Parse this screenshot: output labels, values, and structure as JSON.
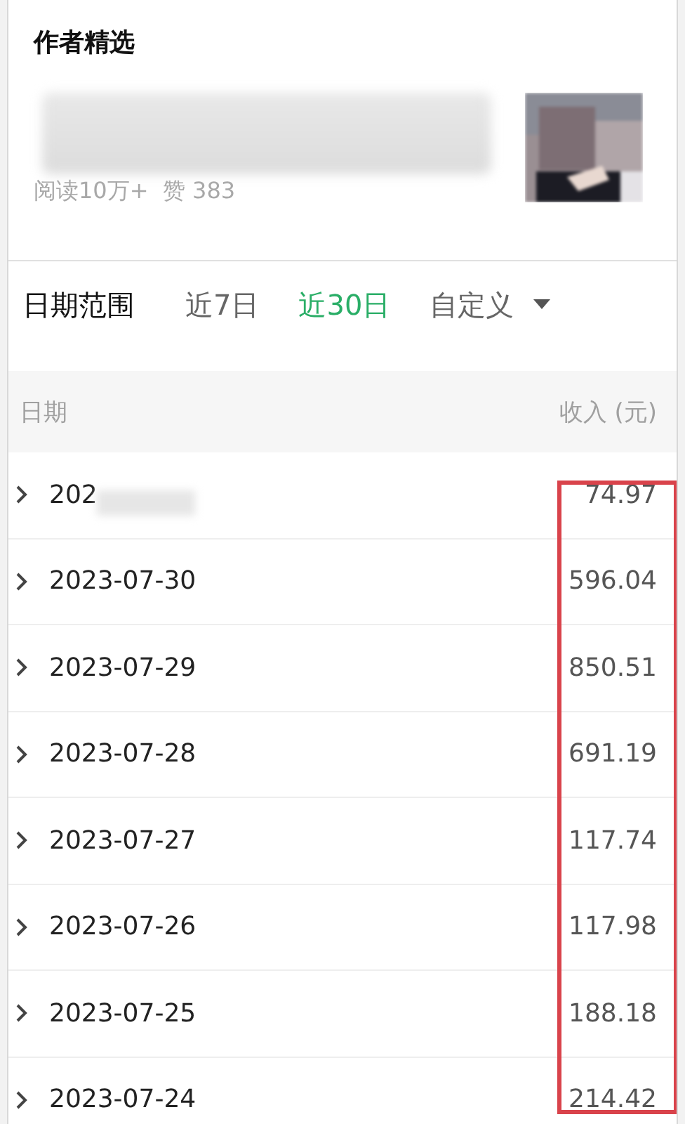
{
  "featured": {
    "title": "作者精选",
    "article": {
      "stats": "阅读10万+  赞 383"
    }
  },
  "date_range": {
    "label": "日期范围",
    "tabs": [
      {
        "label": "近7日",
        "selected": false,
        "dropdown": false
      },
      {
        "label": "近30日",
        "selected": true,
        "dropdown": false
      },
      {
        "label": "自定义",
        "selected": false,
        "dropdown": true
      }
    ]
  },
  "table": {
    "columns": [
      "日期",
      "收入 (元)"
    ],
    "rows": [
      {
        "date": "202",
        "income": "74.97",
        "redacted": true
      },
      {
        "date": "2023-07-30",
        "income": "596.04",
        "redacted": false
      },
      {
        "date": "2023-07-29",
        "income": "850.51",
        "redacted": false
      },
      {
        "date": "2023-07-28",
        "income": "691.19",
        "redacted": false
      },
      {
        "date": "2023-07-27",
        "income": "117.74",
        "redacted": false
      },
      {
        "date": "2023-07-26",
        "income": "117.98",
        "redacted": false
      },
      {
        "date": "2023-07-25",
        "income": "188.18",
        "redacted": false
      },
      {
        "date": "2023-07-24",
        "income": "214.42",
        "redacted": false
      }
    ]
  }
}
